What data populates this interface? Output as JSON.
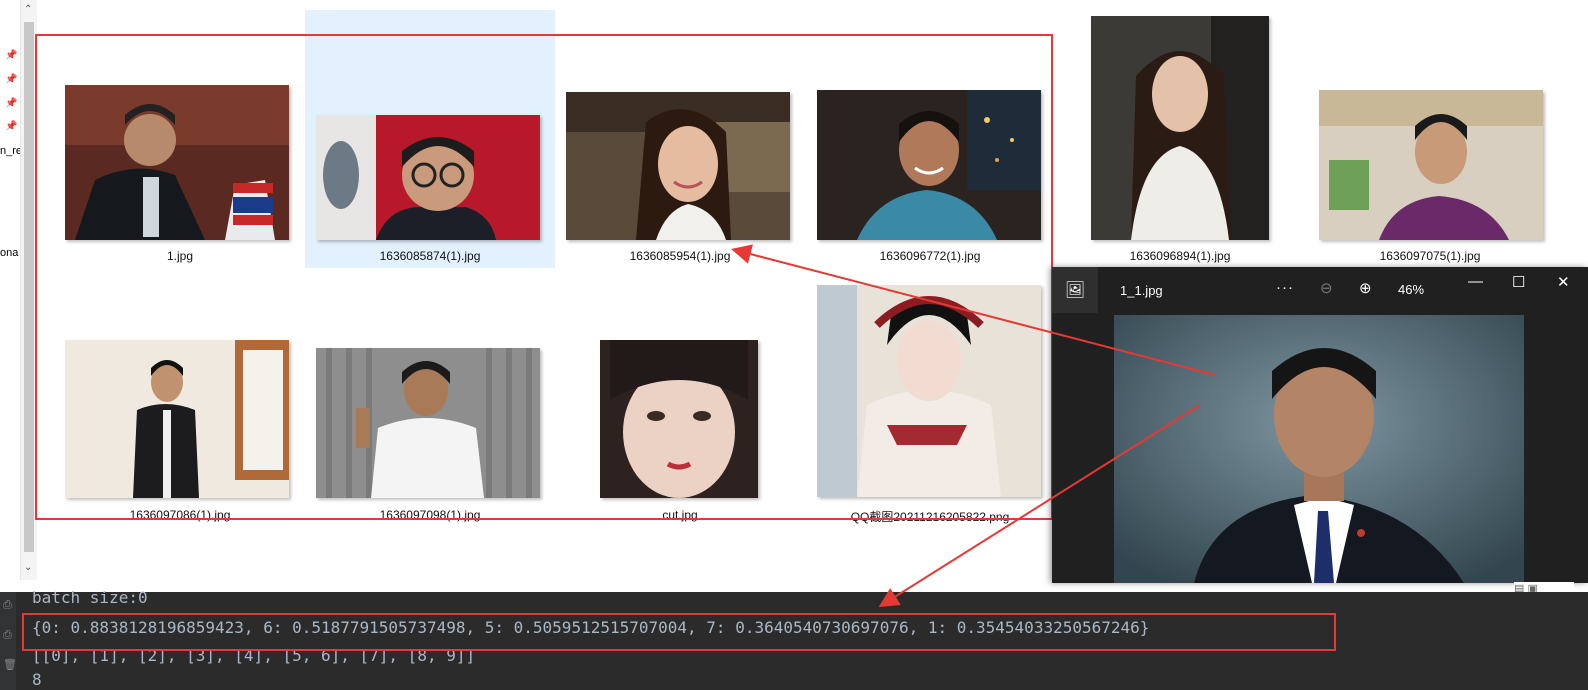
{
  "files": [
    {
      "name": "1.jpg"
    },
    {
      "name": "1636085874(1).jpg"
    },
    {
      "name": "1636085954(1).jpg"
    },
    {
      "name": "1636096772(1).jpg"
    },
    {
      "name": "1636096894(1).jpg"
    },
    {
      "name": "1636097075(1).jpg"
    },
    {
      "name": "1636097086(1).jpg"
    },
    {
      "name": "1636097098(1).jpg"
    },
    {
      "name": "cut.jpg"
    },
    {
      "name": "QQ截图20211216205822.png"
    }
  ],
  "sidebar_fragments": [
    "n_re",
    "ona"
  ],
  "viewer": {
    "title": "1_1.jpg",
    "zoom": "46%",
    "more": "···",
    "zoom_out": "⊖",
    "zoom_in": "⊕"
  },
  "console": {
    "line0": "batch size:0",
    "line1": "{0: 0.8838128196859423, 6: 0.5187791505737498, 5: 0.5059512515707004, 7: 0.3640540730697076, 1: 0.35454033250567246}",
    "line2": "[[0], [1], [2], [3], [4], [5, 6], [7], [8, 9]]",
    "line3": "8"
  },
  "colors": {
    "annotation_red": "#e53935",
    "selection": "#e3f0fd",
    "console_bg": "#2b2b2b",
    "viewer_bg": "#202020"
  }
}
